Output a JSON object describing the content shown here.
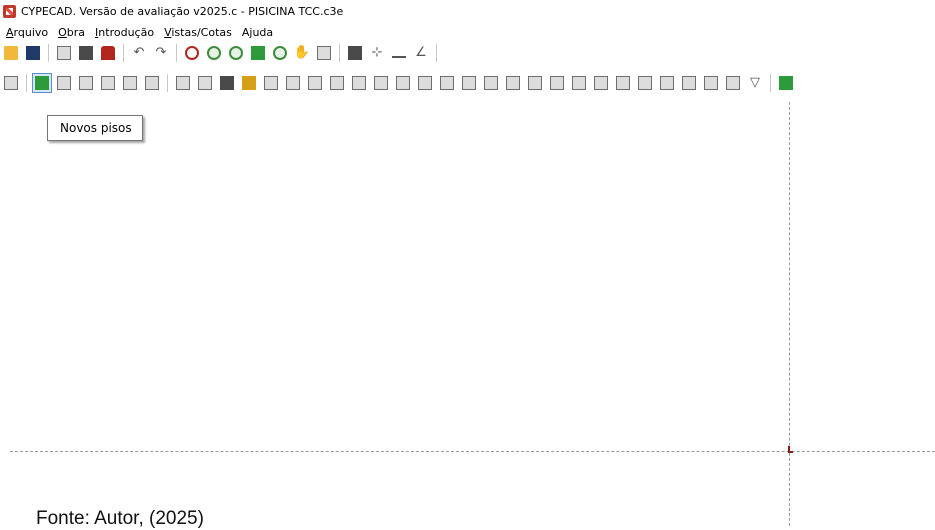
{
  "window": {
    "title": "CYPECAD. Versão de avaliação v2025.c - PISICINA TCC.c3e"
  },
  "menu": {
    "items": [
      {
        "u": "A",
        "rest": "rquivo"
      },
      {
        "u": "O",
        "rest": "bra"
      },
      {
        "u": "I",
        "rest": "ntrodução"
      },
      {
        "u": "V",
        "rest": "istas/Cotas"
      },
      {
        "u": "",
        "rest": "Ajuda"
      }
    ]
  },
  "tooltip": {
    "text": "Novos pisos"
  },
  "caption": {
    "text": "Fonte: Autor, (2025)"
  },
  "colors": {
    "guide_line": "#9a9a9a",
    "origin_mark": "#8b1a1a",
    "active_button_border": "#5b8fc7",
    "active_button_fill": "#d5e6f7"
  },
  "toolbar1_icons": [
    "open-folder-icon",
    "save-icon",
    "print-icon",
    "layout-icon",
    "magnet-icon",
    "undo-icon",
    "redo-icon",
    "zoom-window-icon",
    "zoom-all-icon",
    "zoom-previous-icon",
    "redraw-icon",
    "zoom-out-icon",
    "pan-icon",
    "view-icon",
    "binoculars-icon",
    "snap-icon",
    "dimension-icon",
    "angle-icon"
  ],
  "toolbar2_icons": [
    "floors-icon",
    "new-floors-icon",
    "edit-floors-icon",
    "delete-floors-icon",
    "copy-floors-icon",
    "floor-data-icon",
    "floor-groups-icon",
    "column-icon",
    "column-data-icon",
    "foundation-icon",
    "load-icon",
    "beam-icon",
    "wall-icon",
    "slab-icon",
    "opening-icon",
    "stair-icon",
    "joist-icon",
    "panel-icon",
    "ribbed-icon",
    "hollow-icon",
    "loads-icon",
    "edit-icon",
    "move-icon",
    "table-icon",
    "split-icon",
    "align-icon",
    "merge-icon",
    "k-icon",
    "formula-icon",
    "gradient-icon",
    "support-icon",
    "wall-support-icon",
    "tree-icon",
    "filter-icon",
    "calculate-icon"
  ]
}
